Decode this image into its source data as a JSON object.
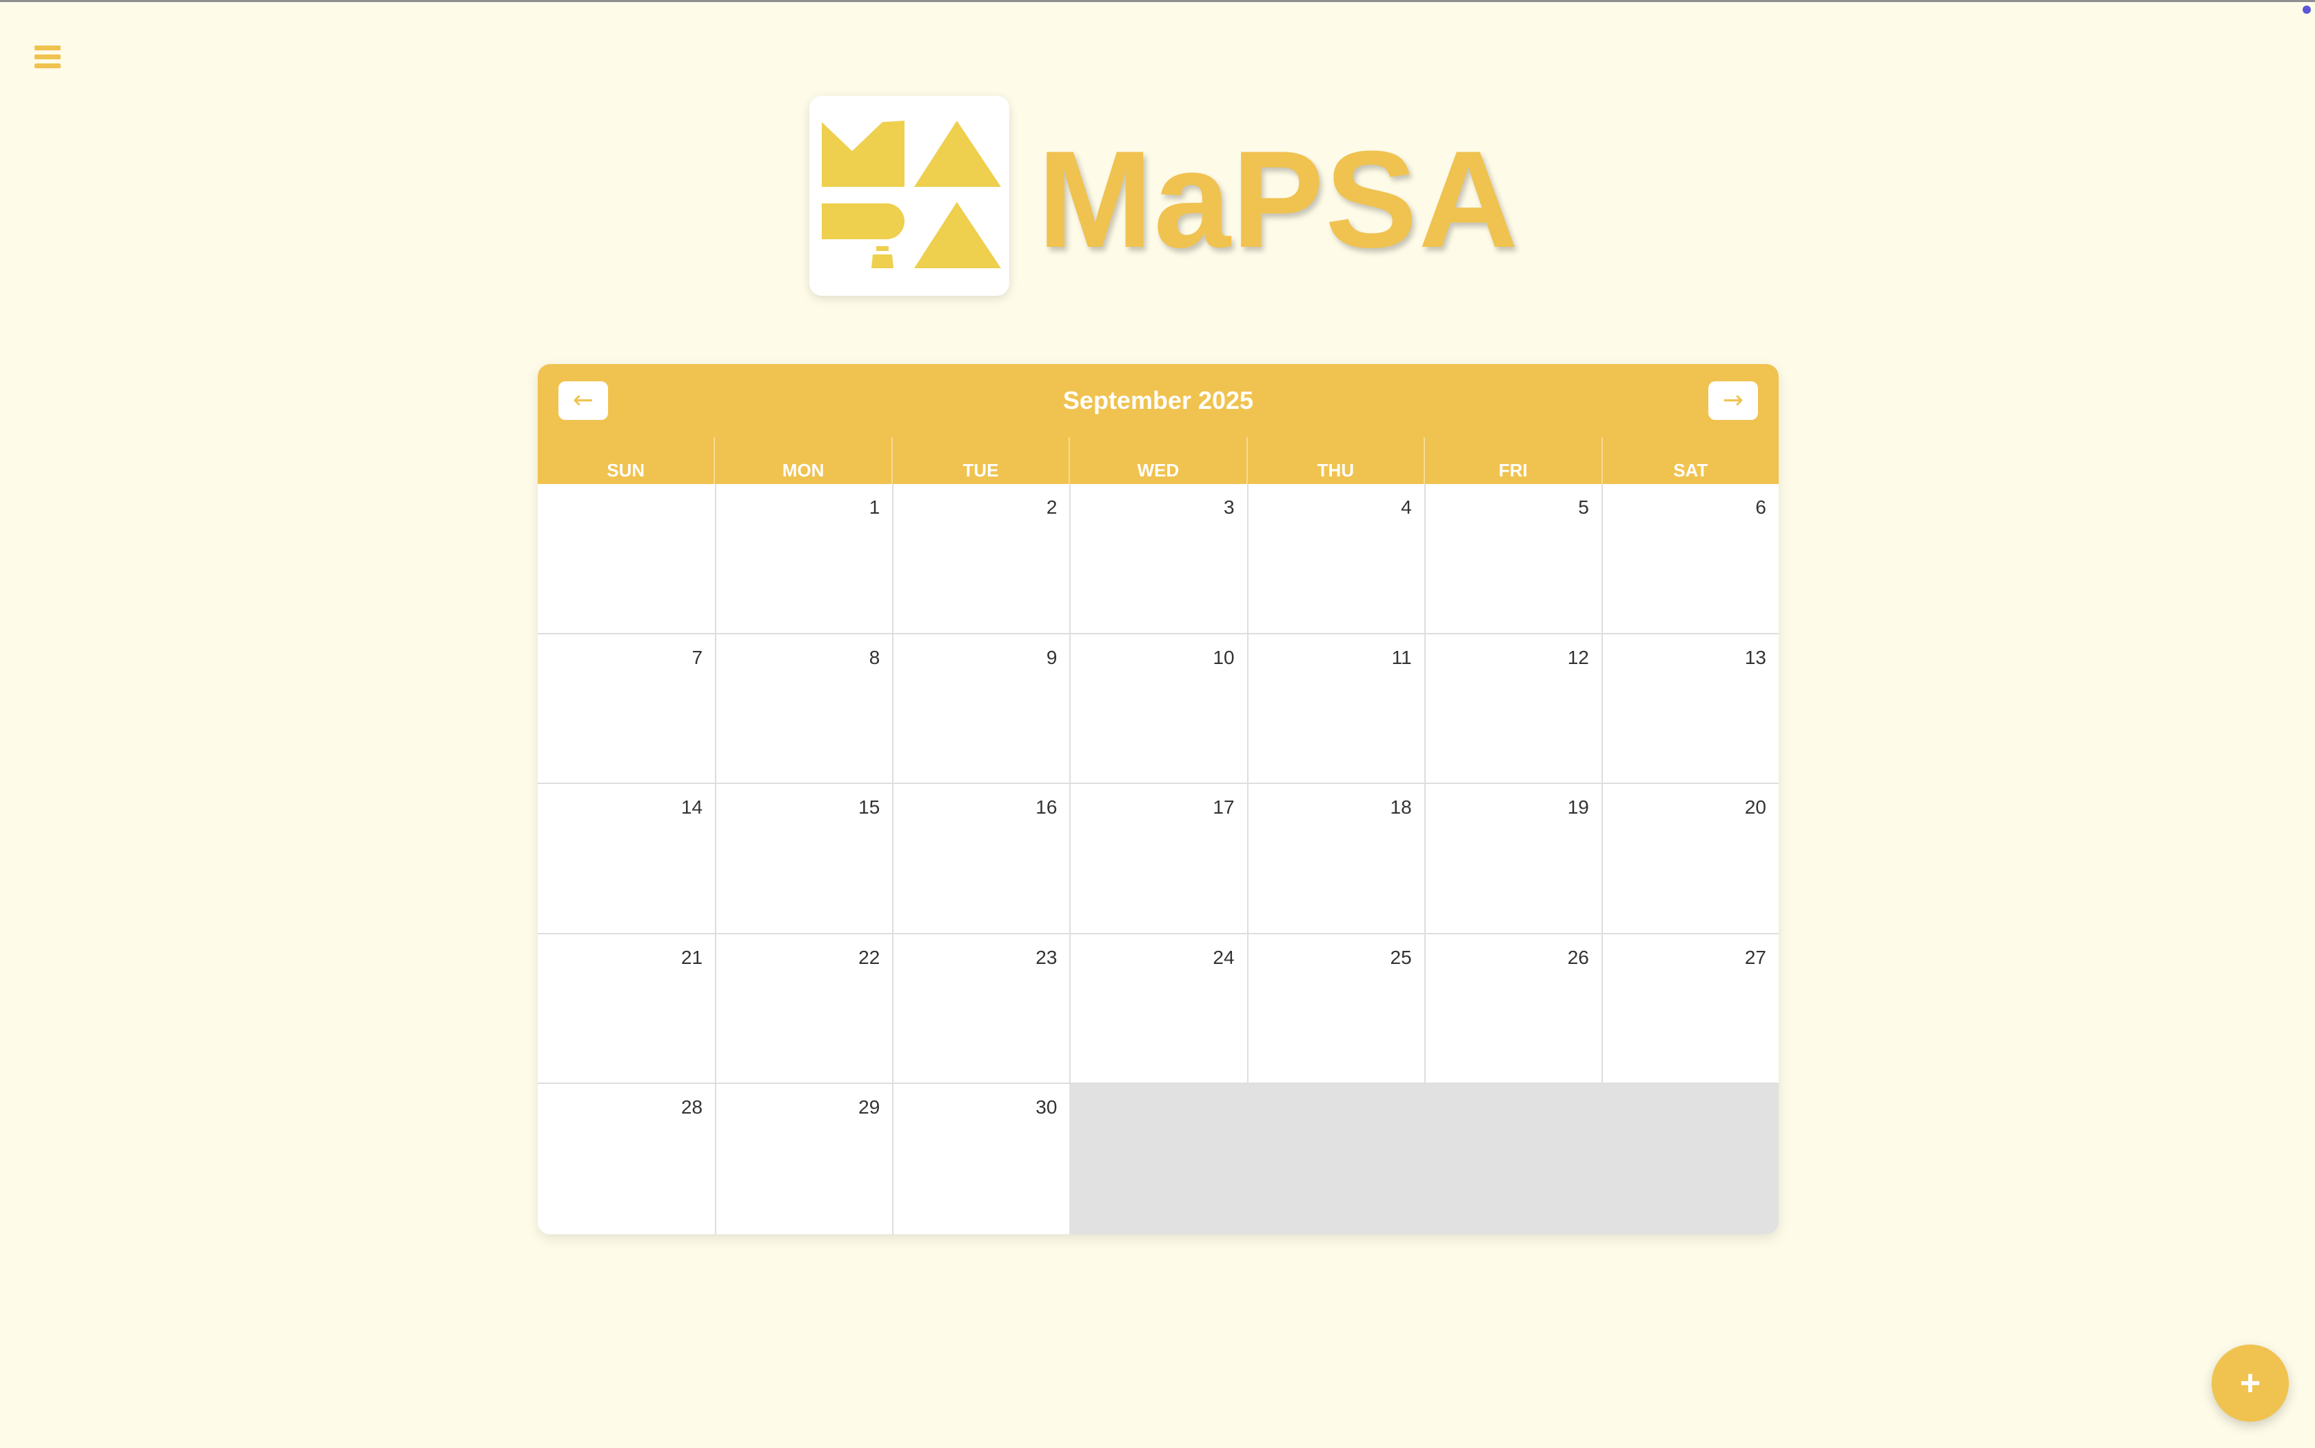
{
  "app": {
    "title": "MaPSA",
    "brand_color": "#f0c24f",
    "background_color": "#fefbe8"
  },
  "nav": {
    "menu_icon": "hamburger-menu-icon"
  },
  "calendar": {
    "month_label": "September 2025",
    "prev_label": "←",
    "next_label": "→",
    "weekdays": [
      "SUN",
      "MON",
      "TUE",
      "WED",
      "THU",
      "FRI",
      "SAT"
    ],
    "weeks": [
      [
        "",
        "1",
        "2",
        "3",
        "4",
        "5",
        "6"
      ],
      [
        "7",
        "8",
        "9",
        "10",
        "11",
        "12",
        "13"
      ],
      [
        "14",
        "15",
        "16",
        "17",
        "18",
        "19",
        "20"
      ],
      [
        "21",
        "22",
        "23",
        "24",
        "25",
        "26",
        "27"
      ],
      [
        "28",
        "29",
        "30"
      ]
    ]
  },
  "fab": {
    "label": "+",
    "icon": "plus-icon"
  }
}
